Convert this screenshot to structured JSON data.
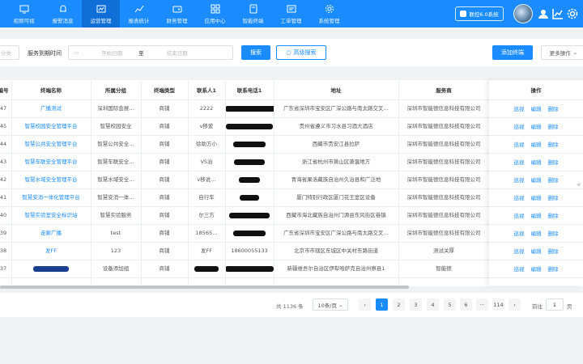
{
  "nav": [
    {
      "label": "视频可视",
      "icon": "monitor-icon"
    },
    {
      "label": "报警消息",
      "icon": "bell-icon"
    },
    {
      "label": "运营管理",
      "icon": "dashboard-icon",
      "active": true
    },
    {
      "label": "报表统计",
      "icon": "chart-icon"
    },
    {
      "label": "财务管理",
      "icon": "wallet-icon"
    },
    {
      "label": "应用中心",
      "icon": "apps-icon"
    },
    {
      "label": "智能终端",
      "icon": "terminal-icon"
    },
    {
      "label": "工单管理",
      "icon": "ticket-icon"
    },
    {
      "label": "系统管理",
      "icon": "gear-icon"
    }
  ],
  "header": {
    "system_button": "联控6.0系统"
  },
  "filter": {
    "first_placeholder": "分类",
    "time_label": "服务到期时间",
    "start_placeholder": "开始日期",
    "separator": "至",
    "end_placeholder": "结束日期",
    "search_button": "搜索",
    "advanced_button": "高级搜索",
    "add_button": "添加终端",
    "more_button": "更多操作"
  },
  "table": {
    "headers": [
      "编号",
      "终端名称",
      "所属分组",
      "终端类型",
      "联系人1",
      "联系电话1",
      "地址",
      "服务商",
      "操作"
    ],
    "rows": [
      {
        "id": "47",
        "name": "广播测试",
        "group": "深圳国际会展…",
        "type": "商铺",
        "contact": "2222",
        "phone": "",
        "address": "广东省深圳市宝安区广深公路与南太路交叉…",
        "provider": "深圳市智能德信息科技有限公司"
      },
      {
        "id": "45",
        "name": "智慧校园安全管理平台",
        "group": "智慧校园安全",
        "type": "商铺",
        "contact": "v移爱",
        "phone": "",
        "address": "贵州省遵义市习水县习酒大酒店",
        "provider": "深圳市智能德信息科技有限公司"
      },
      {
        "id": "44",
        "name": "智慧公共安全管理平台",
        "group": "智慧公共安全…",
        "type": "商铺",
        "contact": "徐助方小",
        "phone": "",
        "address": "西藏市贵安江县拉萨",
        "provider": "深圳市智能德信息科技有限公司"
      },
      {
        "id": "43",
        "name": "智慧车联安全管理平台",
        "group": "智慧车联安全…",
        "type": "商铺",
        "contact": "VS治",
        "phone": "",
        "address": "浙江省杭州市萧山区萧蛋地方",
        "provider": "深圳市智能德信息科技有限公司"
      },
      {
        "id": "42",
        "name": "智慧水域安全管理平台",
        "group": "智慧水域安全…",
        "type": "商铺",
        "contact": "v移说…",
        "phone": "",
        "address": "青海省果洛藏族自治州久治县和广泛地",
        "provider": "深圳市智能德信息科技有限公司"
      },
      {
        "id": "41",
        "name": "智慧安消一体化管理平台",
        "group": "智慧安消一体…",
        "type": "商铺",
        "contact": "自行车",
        "phone": "",
        "address": "厦门特别行政区厦门花王室区设备",
        "provider": "深圳市智能德信息科技有限公司"
      },
      {
        "id": "40",
        "name": "智慧实验室安全标识站",
        "group": "智慧实验服务",
        "type": "商铺",
        "contact": "尔三方",
        "phone": "",
        "address": "西藏市海北藏族自治州门源县东风街区巷镇",
        "provider": "深圳市智能德信息科技有限公司"
      },
      {
        "id": "39",
        "name": "走廊广播",
        "group": "test",
        "type": "商铺",
        "contact": "18565…",
        "phone": "",
        "address": "广东省深圳市宝安区广深公路与南太路交叉…",
        "provider": "深圳市智能德信息科技有限公司"
      },
      {
        "id": "38",
        "name": "发FF",
        "group": "123",
        "type": "商铺",
        "contact": "发FF",
        "phone": "18600055133",
        "address": "北京市市辖区东城区中关村东路街道",
        "provider": "测试关厚"
      },
      {
        "id": "37",
        "name": "",
        "group": "设备添加组",
        "type": "商铺",
        "contact": "",
        "phone": "",
        "address": "新疆维吾尔自治区伊犁哈萨克自治州察县1",
        "provider": "智能德"
      }
    ],
    "actions": [
      "巡视",
      "编辑",
      "删除"
    ]
  },
  "pagination": {
    "total": "共 1136 条",
    "page_size": "10条/页",
    "pages": [
      "1",
      "2",
      "3",
      "4",
      "5",
      "6",
      "···",
      "114"
    ],
    "goto_label": "前往",
    "goto_value": "1",
    "page_unit": "页"
  },
  "colors": {
    "primary": "#1a8cff",
    "topbar": "#1a8cff"
  }
}
